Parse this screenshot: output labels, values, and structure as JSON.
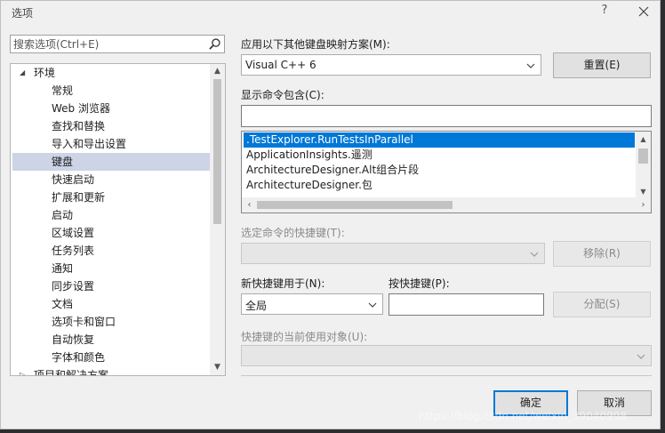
{
  "window": {
    "title": "选项",
    "help_glyph": "?"
  },
  "search": {
    "placeholder": "搜索选项(Ctrl+E)"
  },
  "tree": {
    "root_label": "环境",
    "items": [
      {
        "label": "常规"
      },
      {
        "label": "Web 浏览器"
      },
      {
        "label": "查找和替换"
      },
      {
        "label": "导入和导出设置"
      },
      {
        "label": "键盘",
        "selected": true
      },
      {
        "label": "快速启动"
      },
      {
        "label": "扩展和更新"
      },
      {
        "label": "启动"
      },
      {
        "label": "区域设置"
      },
      {
        "label": "任务列表"
      },
      {
        "label": "通知"
      },
      {
        "label": "同步设置"
      },
      {
        "label": "文档"
      },
      {
        "label": "选项卡和窗口"
      },
      {
        "label": "自动恢复"
      },
      {
        "label": "字体和颜色"
      }
    ],
    "next_root_label": "项目和解决方案"
  },
  "keyboard": {
    "mapping_scheme_label": "应用以下其他键盘映射方案(M):",
    "mapping_scheme_value": "Visual C++ 6",
    "reset_button": "重置(E)",
    "show_commands_label": "显示命令包含(C):",
    "show_commands_value": "",
    "commands": [
      {
        "label": ".TestExplorer.RunTestsInParallel",
        "selected": true
      },
      {
        "label": "ApplicationInsights.遥测"
      },
      {
        "label": "ArchitectureDesigner.Alt组合片段"
      },
      {
        "label": "ArchitectureDesigner.包"
      }
    ],
    "selected_shortcut_label": "选定命令的快捷键(T):",
    "remove_button": "移除(R)",
    "new_shortcut_scope_label": "新快捷键用于(N):",
    "new_shortcut_scope_value": "全局",
    "press_shortcut_label": "按快捷键(P):",
    "press_shortcut_value": "",
    "assign_button": "分配(S)",
    "shortcut_used_by_label": "快捷键的当前使用对象(U):"
  },
  "footer": {
    "ok_button": "确定",
    "cancel_button": "取消"
  },
  "watermark": "https://blog.csdn.net/weixin_39040998",
  "colors": {
    "accent": "#0078d7",
    "tree_selected": "#ccd4e6",
    "dialog_bg": "#f0f0f0"
  }
}
